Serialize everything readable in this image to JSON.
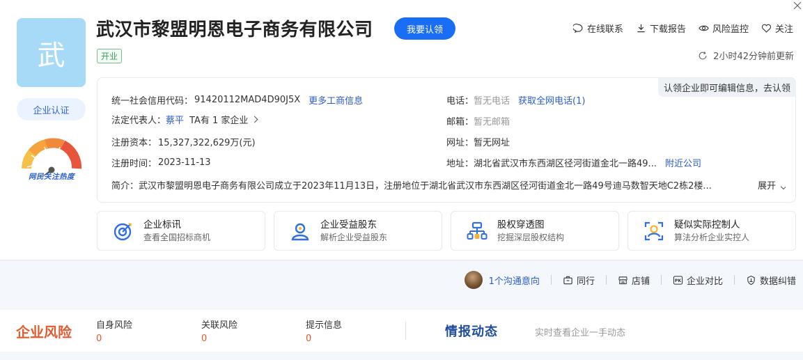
{
  "company": {
    "logo_char": "武",
    "name": "武汉市黎盟明恩电子商务有限公司",
    "claim_button": "我要认领",
    "status": "开业",
    "certification": "企业认证",
    "heat_caption": "网民关注热度"
  },
  "actions": [
    {
      "label": "在线联系",
      "icon": "chat-icon"
    },
    {
      "label": "下载报告",
      "icon": "download-icon"
    },
    {
      "label": "风险监控",
      "icon": "eye-icon"
    },
    {
      "label": "关注",
      "icon": "heart-icon"
    }
  ],
  "update_time": "2小时42分钟前更新",
  "claim_hint": "认领企业即可编辑信息，去认领",
  "info": {
    "credit_code_label": "统一社会信用代码：",
    "credit_code": "91420112MAD4D90J5X",
    "more_link": "更多工商信息",
    "legal_rep_label": "法定代表人：",
    "legal_rep": "蔡平",
    "legal_rep_extra_prefix": "TA有",
    "legal_rep_extra_count": "1",
    "legal_rep_extra_suffix": "家企业",
    "capital_label": "注册资本：",
    "capital": "15,327,322,629万(元)",
    "reg_time_label": "注册时间：",
    "reg_time": "2023-11-13",
    "phone_label": "电话：",
    "phone": "暂无电话",
    "phone_link": "获取全网电话(1)",
    "email_label": "邮箱：",
    "email": "暂无邮箱",
    "website_label": "网址：",
    "website": "暂无网址",
    "address_label": "地址：",
    "address": "湖北省武汉市东西湖区径河街道金北一路49...",
    "nearby_link": "附近公司",
    "intro_label": "简介：",
    "intro": "武汉市黎盟明恩电子商务有限公司成立于2023年11月13日，注册地位于湖北省武汉市东西湖区径河街道金北一路49号迪马数智天地C2栋2楼...",
    "expand": "展开"
  },
  "cards": [
    {
      "title": "企业标讯",
      "sub": "查看全国招标商机",
      "icon": "bid-icon"
    },
    {
      "title": "企业受益股东",
      "sub": "解析企业受益股东",
      "icon": "shareholder-icon"
    },
    {
      "title": "股权穿透图",
      "sub": "挖掘深层股权结构",
      "icon": "equity-tree-icon"
    },
    {
      "title": "疑似实际控制人",
      "sub": "算法分析企业实控人",
      "icon": "controller-icon"
    }
  ],
  "tools": {
    "intent": "1个沟通意向",
    "peers": "同行",
    "shop": "店铺",
    "compare": "企业对比",
    "correct": "数据纠错"
  },
  "risk": {
    "title": "企业风险",
    "items": [
      {
        "label": "自身风险",
        "count": "0"
      },
      {
        "label": "关联风险",
        "count": "0"
      },
      {
        "label": "提示信息",
        "count": "0"
      }
    ]
  },
  "intel": {
    "title": "情报动态",
    "sub": "实时查看企业一手动态"
  },
  "colors": {
    "brand_blue": "#1a6df5",
    "link_blue": "#2a5ccc",
    "risk_orange": "#e25a2d",
    "logo_bg": "#a6daf7"
  }
}
